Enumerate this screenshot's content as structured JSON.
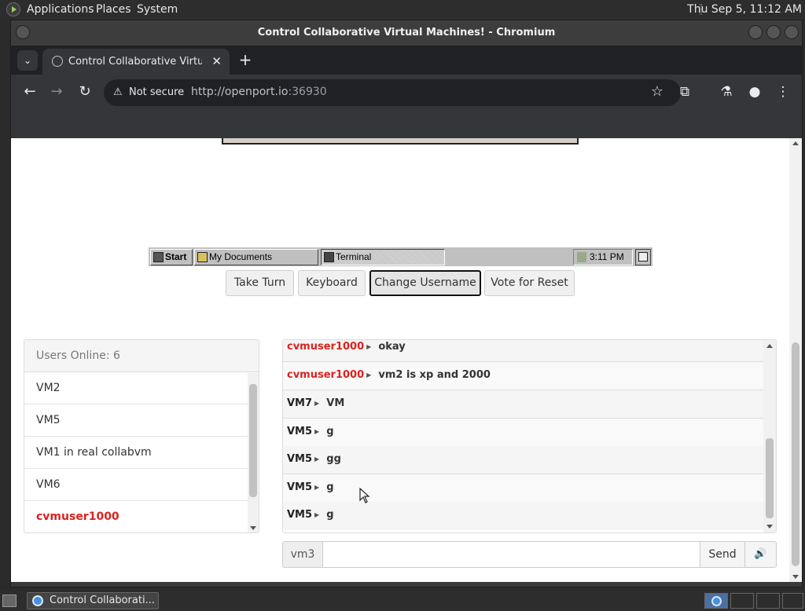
{
  "top_panel": {
    "menus": [
      "Applications",
      "Places",
      "System"
    ],
    "clock": "Thu Sep  5, 11:12 AM"
  },
  "window": {
    "title": "Control Collaborative Virtual Machines! - Chromium"
  },
  "browser": {
    "tab_title": "Control Collaborative Virtual Machines!",
    "tab_close": "✕",
    "new_tab": "+",
    "security_label": "Not secure",
    "url_host": "http://openport.io",
    "url_port": ":36930"
  },
  "vm": {
    "start_label": "Start",
    "tasks": [
      {
        "label": "My Documents"
      },
      {
        "label": "Terminal"
      }
    ],
    "tray_time": "3:11 PM"
  },
  "controls": {
    "take_turn": "Take Turn",
    "keyboard": "Keyboard",
    "change_username": "Change Username",
    "vote_reset": "Vote for Reset"
  },
  "users": {
    "header": "Users Online: 6",
    "list": [
      "VM2",
      "VM5",
      "VM1 in real collabvm",
      "VM6",
      "cvmuser1000"
    ]
  },
  "chat": {
    "messages": [
      {
        "user": "cvmuser1000",
        "text": "okay"
      },
      {
        "user": "cvmuser1000",
        "text": "vm2 is xp and 2000"
      },
      {
        "user": "VM7",
        "text": "VM"
      },
      {
        "user": "VM5",
        "text": "g"
      },
      {
        "user": "VM5",
        "text": "gg"
      },
      {
        "user": "VM5",
        "text": "g"
      },
      {
        "user": "VM5",
        "text": "g"
      }
    ],
    "username_addon": "vm3",
    "input_value": "",
    "send_label": "Send",
    "volume_icon": "speaker-icon"
  },
  "bottom_panel": {
    "task_label": "Control Collaborati..."
  },
  "colors": {
    "own_user": "#d9231f",
    "page_bg": "#ffffff",
    "browser_chrome": "#35363a"
  }
}
